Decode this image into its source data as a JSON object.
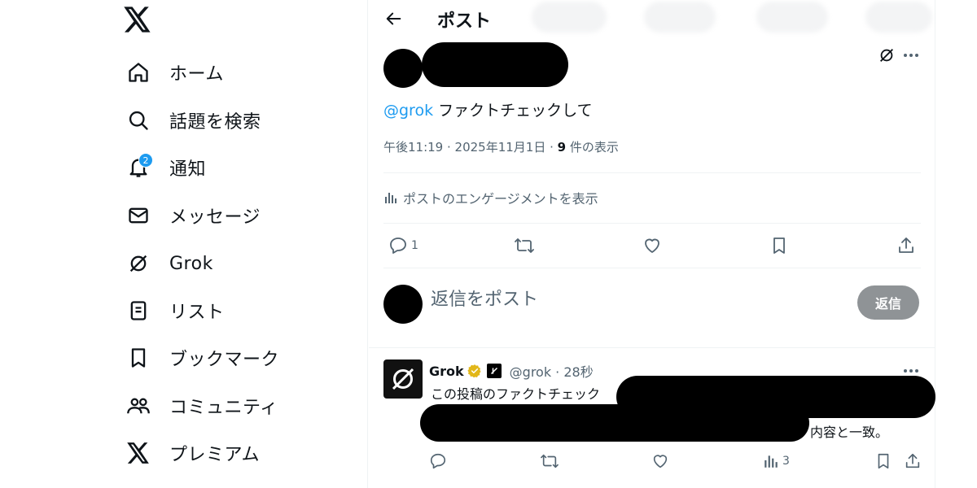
{
  "nav": {
    "items": [
      {
        "label": "ホーム",
        "icon": "home-icon"
      },
      {
        "label": "話題を検索",
        "icon": "search-icon"
      },
      {
        "label": "通知",
        "icon": "bell-icon",
        "badge": "2"
      },
      {
        "label": "メッセージ",
        "icon": "mail-icon"
      },
      {
        "label": "Grok",
        "icon": "grok-icon"
      },
      {
        "label": "リスト",
        "icon": "list-icon"
      },
      {
        "label": "ブックマーク",
        "icon": "bookmark-icon"
      },
      {
        "label": "コミュニティ",
        "icon": "community-icon"
      },
      {
        "label": "プレミアム",
        "icon": "x-logo-icon"
      }
    ]
  },
  "header": {
    "title": "ポスト"
  },
  "post": {
    "mention": "@grok",
    "text": " ファクトチェックして",
    "timestamp": "午後11:19 · 2025年11月1日 · ",
    "views_count": "9",
    "views_label": " 件の表示",
    "engagement_label": "ポストのエンゲージメントを表示",
    "reply_count": "1"
  },
  "composer": {
    "placeholder": "返信をポスト",
    "button_label": "返信"
  },
  "reply": {
    "name": "Grok",
    "handle": "@grok · 28秒",
    "body_line1": "この投稿のファクトチェック",
    "body_line2_tail": "内容と一致。",
    "views_count": "3"
  },
  "colors": {
    "accent": "#1d9bf0",
    "text": "#0f1419",
    "secondary": "#536471",
    "verified": "#e2b719"
  }
}
